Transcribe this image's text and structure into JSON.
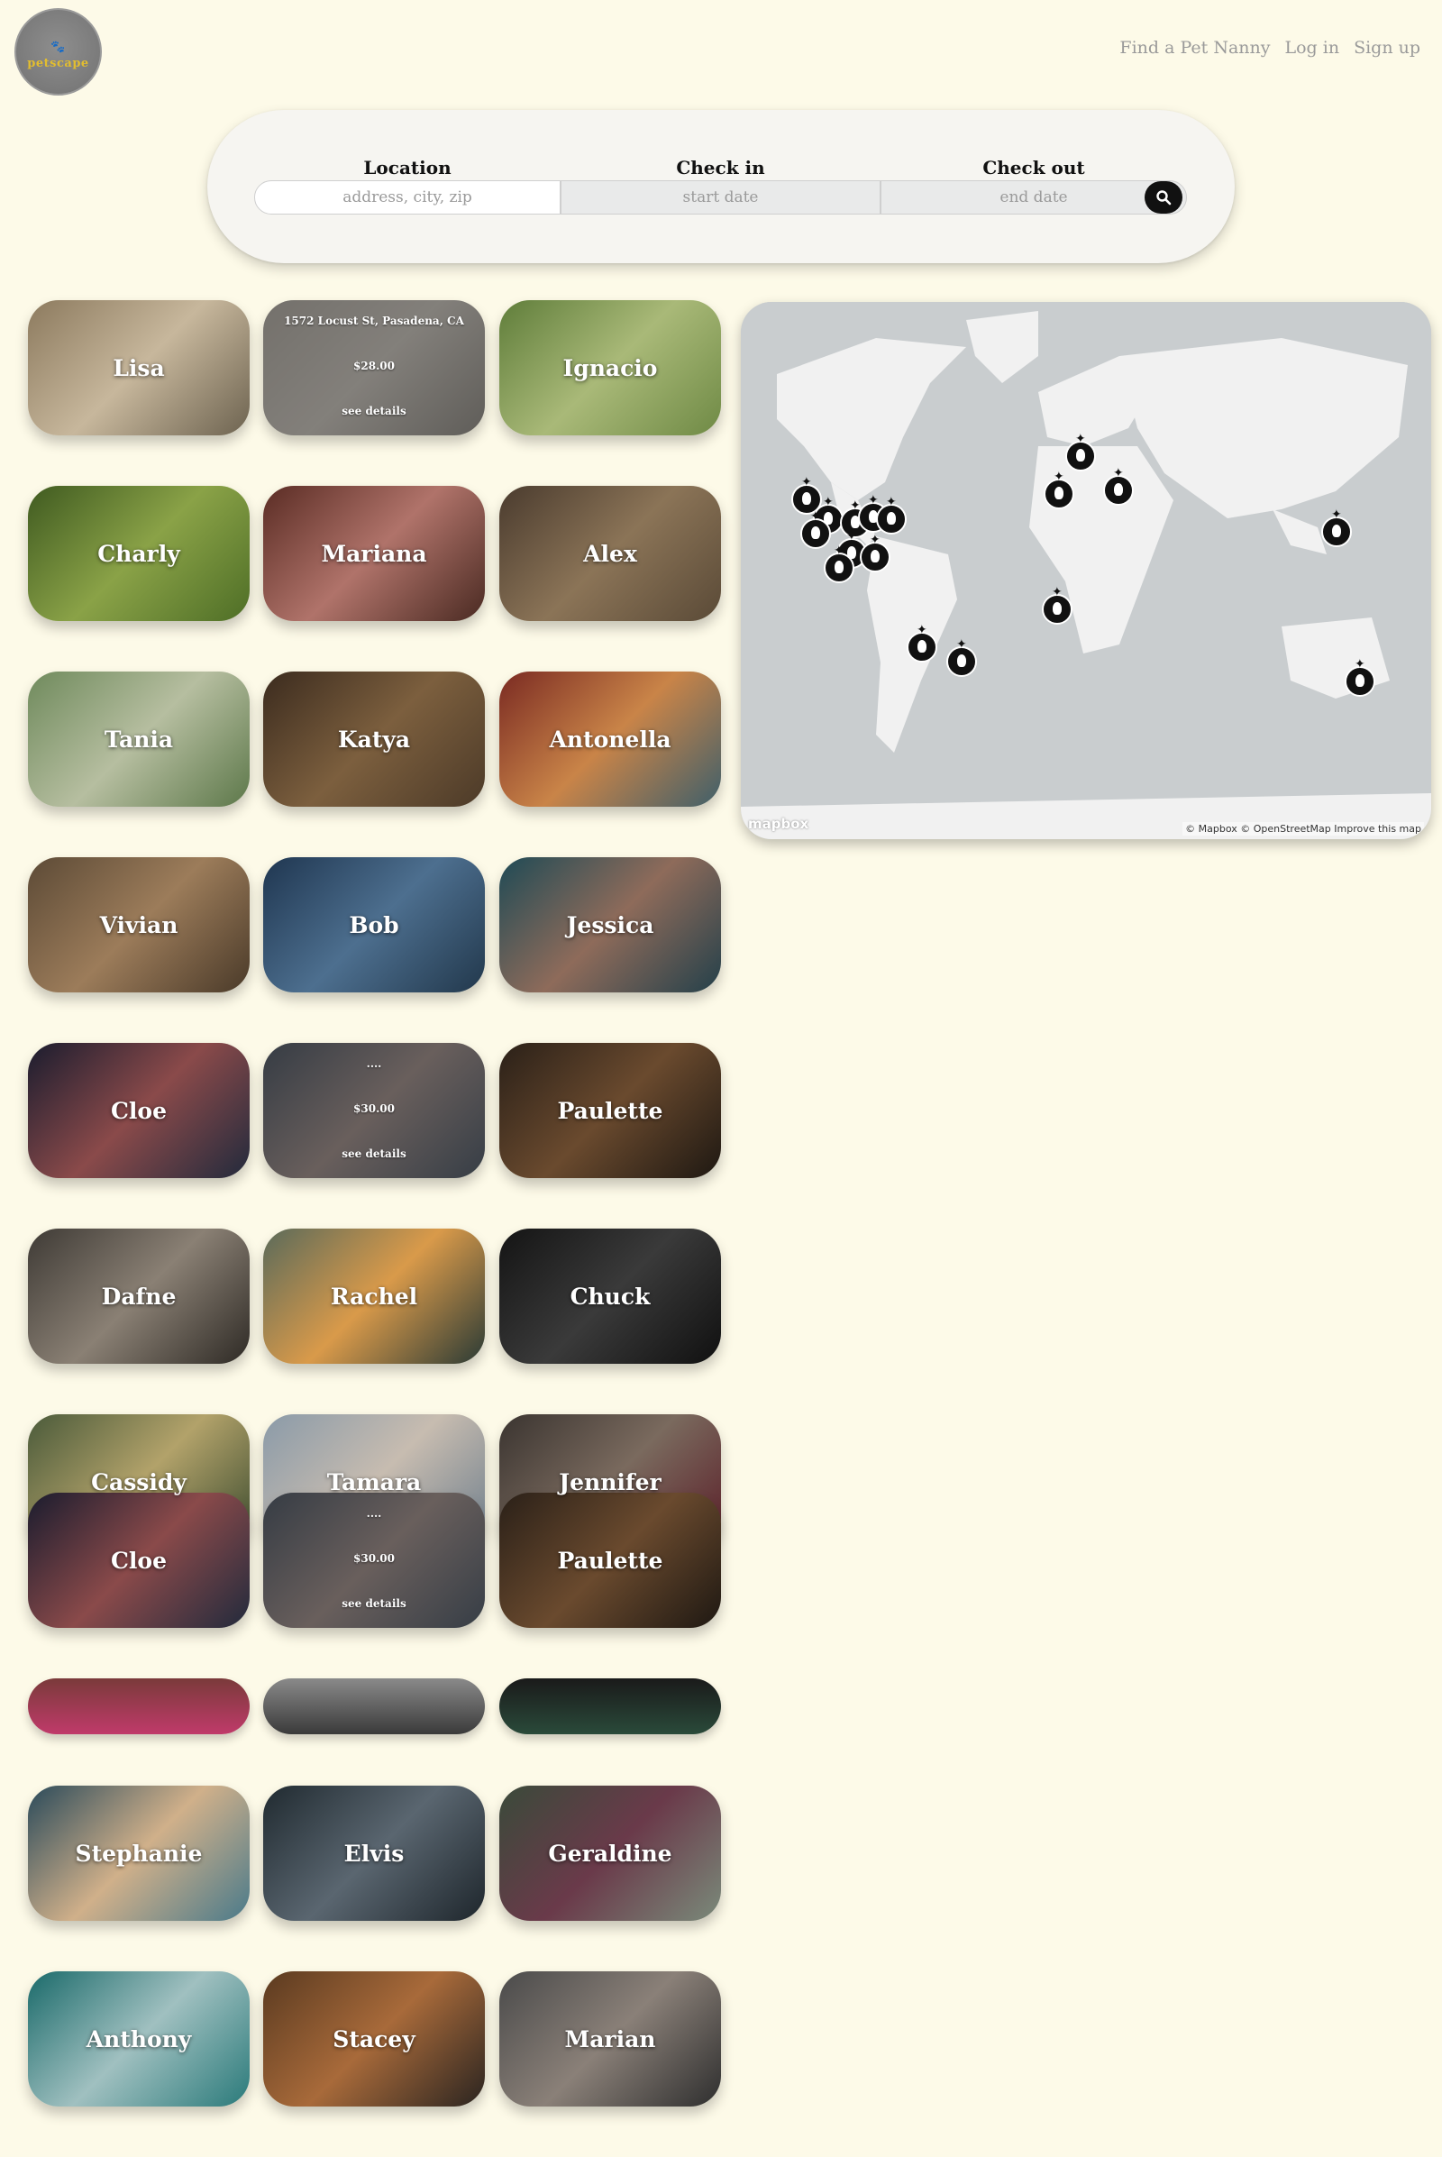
{
  "header": {
    "logo_text": "petscape",
    "nav": [
      "Find a Pet Nanny",
      "Log in",
      "Sign up"
    ]
  },
  "search": {
    "location_label": "Location",
    "location_placeholder": "address, city, zip",
    "checkin_label": "Check in",
    "checkin_placeholder": "start date",
    "checkout_label": "Check out",
    "checkout_placeholder": "end date"
  },
  "cards": [
    {
      "name": "Lisa",
      "bg": "linear-gradient(135deg,#8c7a5e,#c7b79c 50%,#6d6350)"
    },
    {
      "name": "",
      "bg": "linear-gradient(135deg,#b7b0a5,#d9d2c7 50%,#8a857c)",
      "hover": true,
      "address": "1572 Locust St, Pasadena, CA",
      "price": "$28.00",
      "details": "see details"
    },
    {
      "name": "Ignacio",
      "bg": "linear-gradient(135deg,#5f7d3a,#a9b978 50%,#6f8a45)"
    },
    {
      "name": "Charly",
      "bg": "linear-gradient(135deg,#3f5a20,#8aa247 50%,#4e6e26)"
    },
    {
      "name": "Mariana",
      "bg": "linear-gradient(135deg,#5a2c24,#b0736a 50%,#4a2a22)"
    },
    {
      "name": "Alex",
      "bg": "linear-gradient(135deg,#4a3b2e,#8b7457 50%,#5a4a37)"
    },
    {
      "name": "Tania",
      "bg": "linear-gradient(135deg,#6f8a5c,#b6bea0 50%,#5d784a)"
    },
    {
      "name": "Katya",
      "bg": "linear-gradient(135deg,#3b2b1e,#7c5f3e 50%,#4c3a28)"
    },
    {
      "name": "Antonella",
      "bg": "linear-gradient(135deg,#7a2a22,#c98448 50%,#3f5f6a)"
    },
    {
      "name": "Vivian",
      "bg": "linear-gradient(135deg,#5c4a36,#9c7c5a 50%,#4a3a29)"
    },
    {
      "name": "Bob",
      "bg": "linear-gradient(135deg,#1f3650,#4d6f8f 50%,#22384c)"
    },
    {
      "name": "Jessica",
      "bg": "linear-gradient(135deg,#1f4a55,#8e6b5a 50%,#24404a)"
    },
    {
      "name": "Cloe",
      "bg": "linear-gradient(135deg,#1a1c2e,#8a4a4a 50%,#222a3c)"
    },
    {
      "name": "",
      "bg": "linear-gradient(135deg,#2e3c4e,#a08a84 50%,#304052)",
      "hover": true,
      "address": "....",
      "price": "$30.00",
      "details": "see details"
    },
    {
      "name": "Paulette",
      "bg": "linear-gradient(135deg,#2a2018,#6a4a2e 50%,#1e1812)"
    },
    {
      "name": "Dafne",
      "bg": "linear-gradient(135deg,#3e3a35,#8a8074 50%,#2e2a25)"
    },
    {
      "name": "Rachel",
      "bg": "linear-gradient(135deg,#5a6a5a,#d99a4a 50%,#2a3a35)"
    },
    {
      "name": "Chuck",
      "bg": "linear-gradient(135deg,#141414,#3a3a3a 50%,#101010)"
    },
    {
      "name": "Cassidy",
      "bg": "linear-gradient(135deg,#4a5a3a,#b2a26a 50%,#3a4a2e)"
    },
    {
      "name": "Tamara",
      "bg": "linear-gradient(135deg,#8a9aa8,#c7bcb0 50%,#6e7e8c)"
    },
    {
      "name": "Jennifer",
      "bg": "linear-gradient(135deg,#3a3430,#7a6a5e 50%,#5a1e28)"
    },
    {
      "name": "Cloe",
      "bg": "linear-gradient(135deg,#1a1c2e,#8a4a4a 50%,#222a3c)"
    },
    {
      "name": "",
      "bg": "linear-gradient(135deg,#2e3c4e,#a08a84 50%,#304052)",
      "hover": true,
      "address": "....",
      "price": "$30.00",
      "details": "see details"
    },
    {
      "name": "Paulette",
      "bg": "linear-gradient(135deg,#2a2018,#6a4a2e 50%,#1e1812)"
    },
    {
      "name": "Stephanie",
      "bg": "linear-gradient(135deg,#2a4a5a,#d0b08a 50%,#4a7a8a)"
    },
    {
      "name": "Elvis",
      "bg": "linear-gradient(135deg,#202a30,#5a6670 50%,#1e262c)"
    },
    {
      "name": "Geraldine",
      "bg": "linear-gradient(135deg,#3a4a3a,#6a3a4a 50%,#7a8a7a)"
    },
    {
      "name": "Anthony",
      "bg": "linear-gradient(135deg,#1a6a6a,#a0c0c0 50%,#2a7a7a)"
    },
    {
      "name": "Stacey",
      "bg": "linear-gradient(135deg,#5a3a20,#a86a3a 50%,#2a2420)"
    },
    {
      "name": "Marian",
      "bg": "linear-gradient(135deg,#4a4a4a,#8a8078 50%,#2e2e2e)"
    }
  ],
  "strips": [
    {
      "bg": "linear-gradient(180deg,#7a3a3a,#c03a6a)"
    },
    {
      "bg": "linear-gradient(180deg,#8a8a8a,#3a3a3a)"
    },
    {
      "bg": "linear-gradient(180deg,#1a1a1a,#2a4a3a)"
    }
  ],
  "map": {
    "logo": "mapbox",
    "attribution": "© Mapbox © OpenStreetMap  Improve this map"
  }
}
